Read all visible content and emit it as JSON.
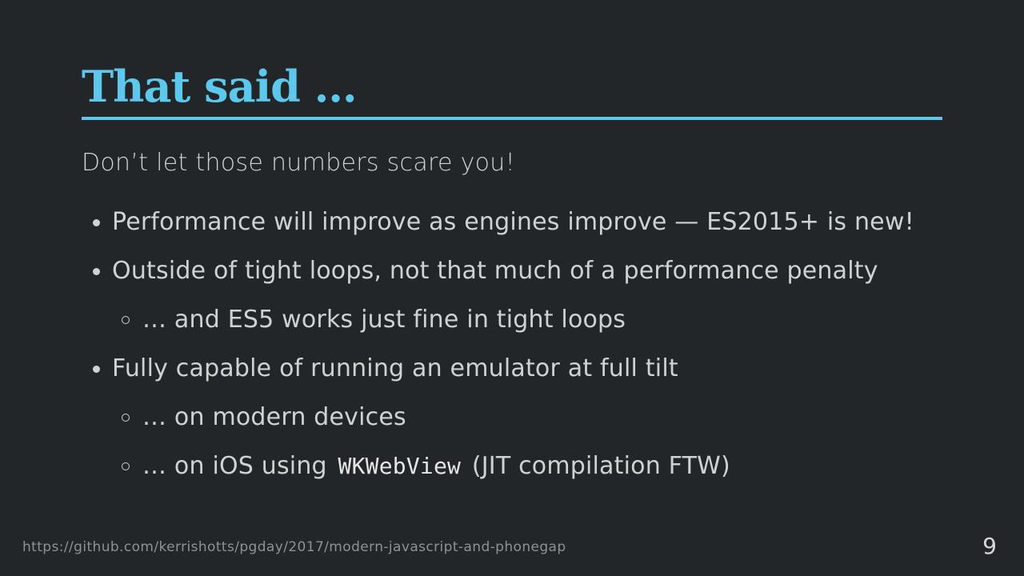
{
  "slide": {
    "title": "That said …",
    "lead": "Don’t let those numbers scare you!",
    "bullets": [
      {
        "level": 1,
        "text": "Performance will improve as engines improve — ES2015+ is new!"
      },
      {
        "level": 1,
        "text": "Outside of tight loops, not that much of a performance penalty"
      },
      {
        "level": 2,
        "text": "… and ES5 works just fine in tight loops"
      },
      {
        "level": 1,
        "text": "Fully capable of running an emulator at full tilt"
      },
      {
        "level": 2,
        "text": "… on modern devices"
      },
      {
        "level": 2,
        "text_before": "… on iOS using ",
        "code": "WKWebView",
        "text_after": " (JIT compilation FTW)"
      }
    ],
    "footer_url": "https://github.com/kerrishotts/pgday/2017/modern-javascript-and-phonegap",
    "page_number": "9"
  },
  "colors": {
    "background": "#232628",
    "accent": "#5ec7ec",
    "text": "#cfd2d3",
    "footer_text": "#8e9294"
  }
}
